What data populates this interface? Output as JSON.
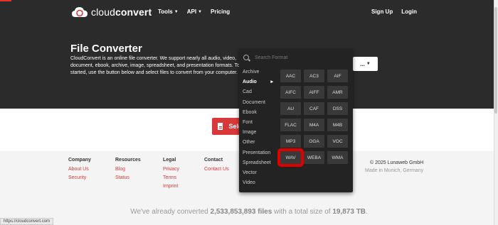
{
  "header": {
    "logo_text_a": "cloud",
    "logo_text_b": "convert",
    "nav": [
      "Tools",
      "API",
      "Pricing"
    ],
    "sign_up": "Sign Up",
    "login": "Login"
  },
  "hero": {
    "title": "File Converter",
    "description": "CloudConvert is an online file converter. We support nearly all audio, video, document, ebook, archive, image, spreadsheet, and presentation formats. To get started, use the button below and select files to convert from your computer.",
    "more_button": "..."
  },
  "select_button": {
    "label": "Sele"
  },
  "dropdown": {
    "search_placeholder": "Search Format",
    "categories": [
      "Archive",
      "Audio",
      "Cad",
      "Document",
      "Ebook",
      "Font",
      "Image",
      "Other",
      "Presentation",
      "Spreadsheet",
      "Vector",
      "Video"
    ],
    "active_category": "Audio",
    "formats": [
      "AAC",
      "AC3",
      "AIF",
      "AIFC",
      "AIFF",
      "AMR",
      "AU",
      "CAF",
      "DSS",
      "FLAC",
      "M4A",
      "M4B",
      "MP3",
      "OGA",
      "VOC",
      "WAV",
      "WEBA",
      "WMA"
    ],
    "highlighted_format": "WAV"
  },
  "footer": {
    "columns": [
      {
        "heading": "Company",
        "links": [
          "About Us",
          "Security"
        ]
      },
      {
        "heading": "Resources",
        "links": [
          "Blog",
          "Status"
        ]
      },
      {
        "heading": "Legal",
        "links": [
          "Privacy",
          "Terms",
          "Imprint"
        ]
      },
      {
        "heading": "Contact",
        "links": [
          "Contact Us"
        ]
      }
    ],
    "copyright": "© 2025 Lunaweb GmbH",
    "made_in": "Made in Munich, Germany",
    "stats_prefix": "We've already converted ",
    "stats_files": "2,533,853,893 files",
    "stats_mid": " with a total size of ",
    "stats_size": "19,873 TB",
    "stats_suffix": "."
  },
  "status_bar": "https://cloudconvert.com",
  "colors": {
    "accent": "#d9383a",
    "hero_bg": "#2b2b2b",
    "dropdown_bg": "#232323",
    "highlight": "#e00000"
  }
}
